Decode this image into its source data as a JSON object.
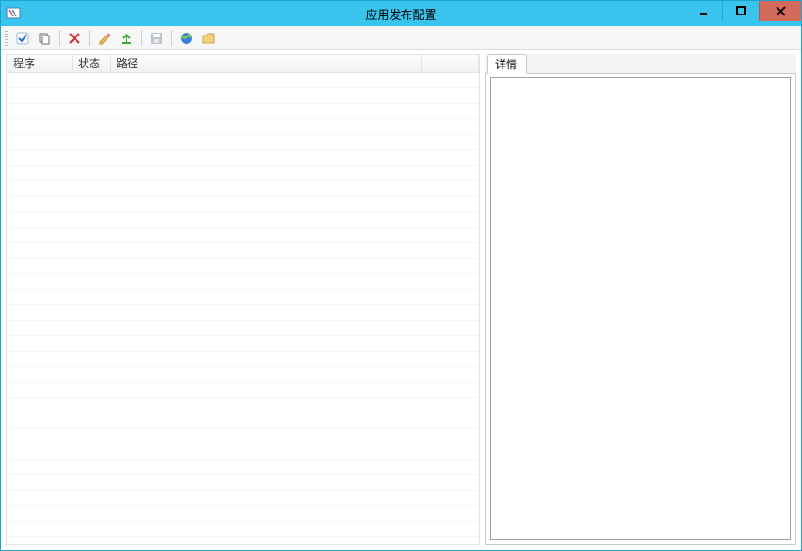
{
  "window": {
    "title": "应用发布配置"
  },
  "toolbar": {
    "items": [
      {
        "name": "check-icon"
      },
      {
        "name": "copy-icon"
      },
      {
        "sep": true
      },
      {
        "name": "delete-icon"
      },
      {
        "sep": true
      },
      {
        "name": "edit-icon"
      },
      {
        "name": "export-icon"
      },
      {
        "sep": true
      },
      {
        "name": "save-icon",
        "disabled": true
      },
      {
        "sep": true
      },
      {
        "name": "globe-icon"
      },
      {
        "name": "folder-icon"
      }
    ]
  },
  "list": {
    "columns": {
      "program": "程序",
      "status": "状态",
      "path": "路径",
      "extra": ""
    },
    "rows": []
  },
  "details": {
    "tab_label": "详情",
    "content": ""
  }
}
